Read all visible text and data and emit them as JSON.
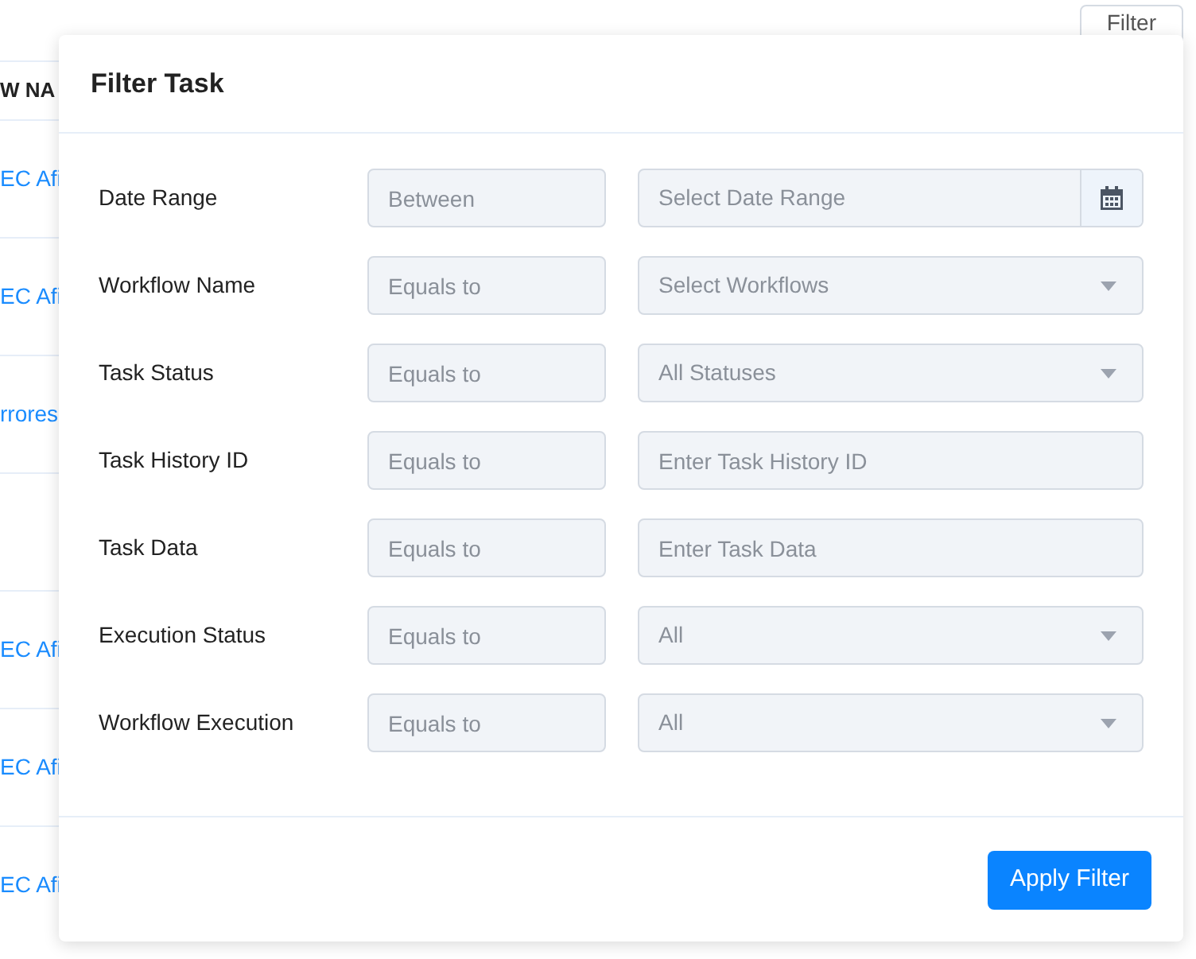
{
  "toolbar": {
    "filter_button": "Filter"
  },
  "table": {
    "column_header": "W NA",
    "rows": [
      "EC Afi",
      "EC Afi",
      "rrores",
      "",
      "EC Afi",
      "EC Afi",
      "EC Afi"
    ]
  },
  "dialog": {
    "title": "Filter Task",
    "fields": [
      {
        "label": "Date Range",
        "operator": "Between",
        "kind": "date",
        "placeholder": "Select Date Range"
      },
      {
        "label": "Workflow Name",
        "operator": "Equals to",
        "kind": "select",
        "placeholder": "Select Workflows"
      },
      {
        "label": "Task Status",
        "operator": "Equals to",
        "kind": "select",
        "placeholder": "All Statuses"
      },
      {
        "label": "Task History ID",
        "operator": "Equals to",
        "kind": "text",
        "placeholder": "Enter Task History ID"
      },
      {
        "label": "Task Data",
        "operator": "Equals to",
        "kind": "text",
        "placeholder": "Enter Task Data"
      },
      {
        "label": "Execution Status",
        "operator": "Equals to",
        "kind": "select",
        "placeholder": "All"
      },
      {
        "label": "Workflow Execution",
        "operator": "Equals to",
        "kind": "select",
        "placeholder": "All"
      }
    ],
    "apply_button": "Apply Filter"
  }
}
